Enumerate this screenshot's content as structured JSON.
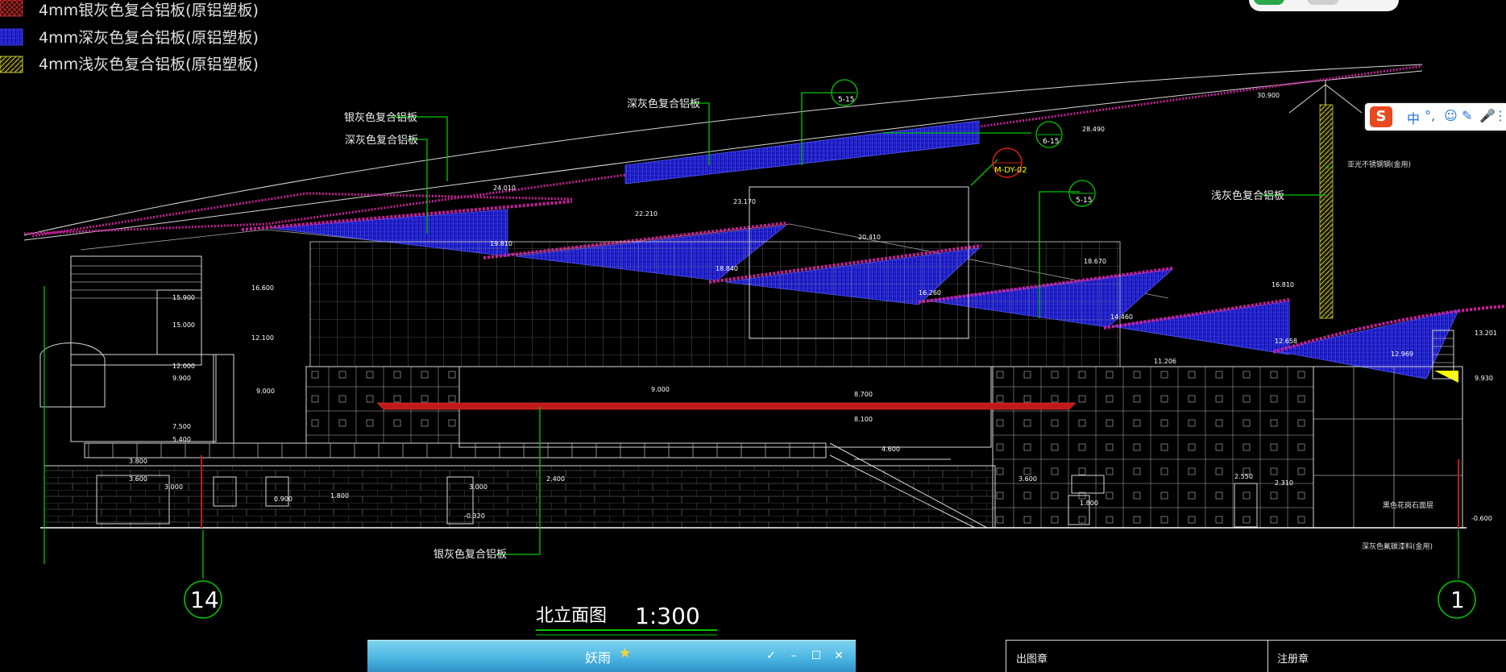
{
  "legend": [
    {
      "label": "4mm银灰色复合铝板(原铝塑板)",
      "color": "#cc1a1a"
    },
    {
      "label": "4mm深灰色复合铝板(原铝塑板)",
      "color": "#1a1acc"
    },
    {
      "label": "4mm浅灰色复合铝板(原铝塑板)",
      "color": "#c8c828"
    }
  ],
  "callouts": {
    "silver_panel_top": "银灰色复合铝板",
    "dark_panel_left": "深灰色复合铝板",
    "dark_panel_mid": "深灰色复合铝板",
    "light_panel_right": "浅灰色复合铝板",
    "silver_panel_bottom": "银灰色复合铝板",
    "steel_note": "亚光不锈钢钢(金用)",
    "stone_note": "黑色花岗石面层",
    "paint_note": "深灰色氟碳漆料(金用)"
  },
  "section_tags": {
    "tag_a": "5-15",
    "tag_b": "6-15",
    "tag_c": "5-15",
    "tag_red": "M-DY-02"
  },
  "elevations": {
    "e30900": "30.900",
    "e28490": "28.490",
    "e24010": "24.010",
    "e23170": "23.170",
    "e22210": "22.210",
    "e20410": "20.410",
    "e19810": "19.810",
    "e18840": "18.840",
    "e18670": "18.670",
    "e16260": "16.260",
    "e16810": "16.810",
    "e16600": "16.600",
    "e15900": "15.900",
    "e15000": "15.000",
    "e14460": "14.460",
    "e13201": "13.201",
    "e12969": "12.969",
    "e12658": "12.658",
    "e12100": "12.100",
    "e12000": "12.000",
    "e11206": "11.206",
    "e9900": "9.900",
    "e9930": "9.930",
    "e9000a": "9.000",
    "e9000b": "9.000",
    "e8700": "8.700",
    "e8100": "8.100",
    "e7500": "7.500",
    "e5400": "5.400",
    "e4600": "4.600",
    "e3800": "3.800",
    "e3600a": "3.600",
    "e3600b": "3.600",
    "e3000a": "3.000",
    "e3000b": "3.000",
    "e2400": "2.400",
    "e2550": "2.550",
    "e2310": "2.310",
    "e1800a": "1.800",
    "e1800b": "1.800",
    "e0900": "0.900",
    "e0320": "-0.320",
    "e0600": "-0.600"
  },
  "axes": {
    "left": "14",
    "right": "1"
  },
  "drawing_title": "北立面图",
  "scale": "1:300",
  "taskbar": {
    "title": "妖雨",
    "btn_check": "✓",
    "btn_min": "–",
    "btn_max": "☐",
    "btn_close": "✕"
  },
  "title_block": {
    "left": "出图章",
    "right": "注册章"
  },
  "ime": {
    "logo": "S",
    "mode": "中"
  }
}
